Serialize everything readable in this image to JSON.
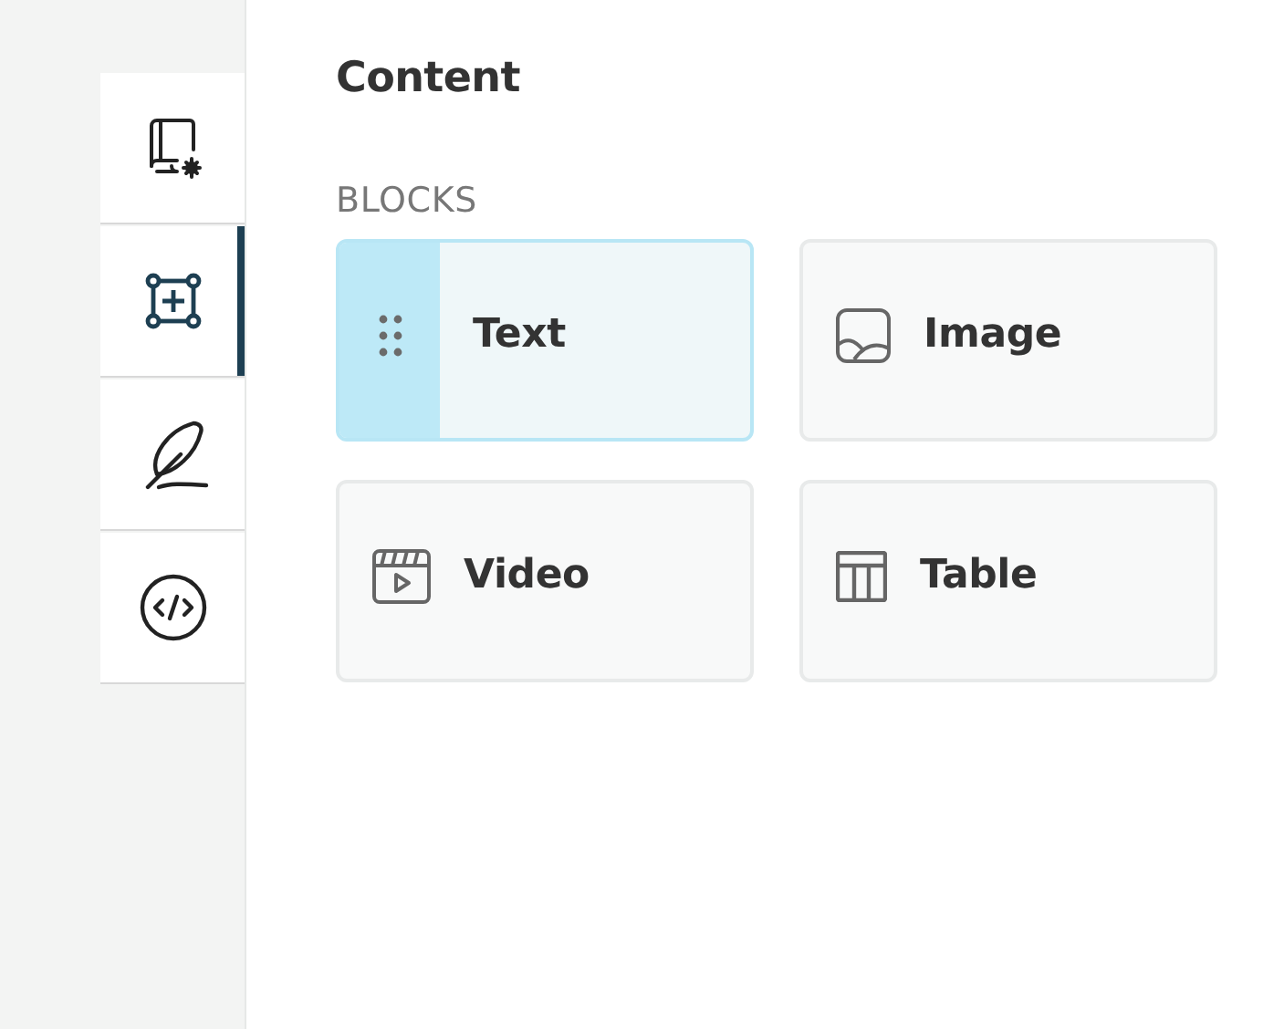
{
  "sidebar": {
    "tabs": [
      {
        "kind": "book-settings",
        "selected": false
      },
      {
        "kind": "add-block",
        "selected": true
      },
      {
        "kind": "feather",
        "selected": false
      },
      {
        "kind": "code",
        "selected": false
      }
    ]
  },
  "content": {
    "title": "Content",
    "section_label": "BLOCKS",
    "blocks": [
      {
        "label": "Text",
        "selected": true
      },
      {
        "kind": "image",
        "label": "Image",
        "selected": false
      },
      {
        "kind": "video",
        "label": "Video",
        "selected": false
      },
      {
        "kind": "table",
        "label": "Table",
        "selected": false
      }
    ]
  }
}
